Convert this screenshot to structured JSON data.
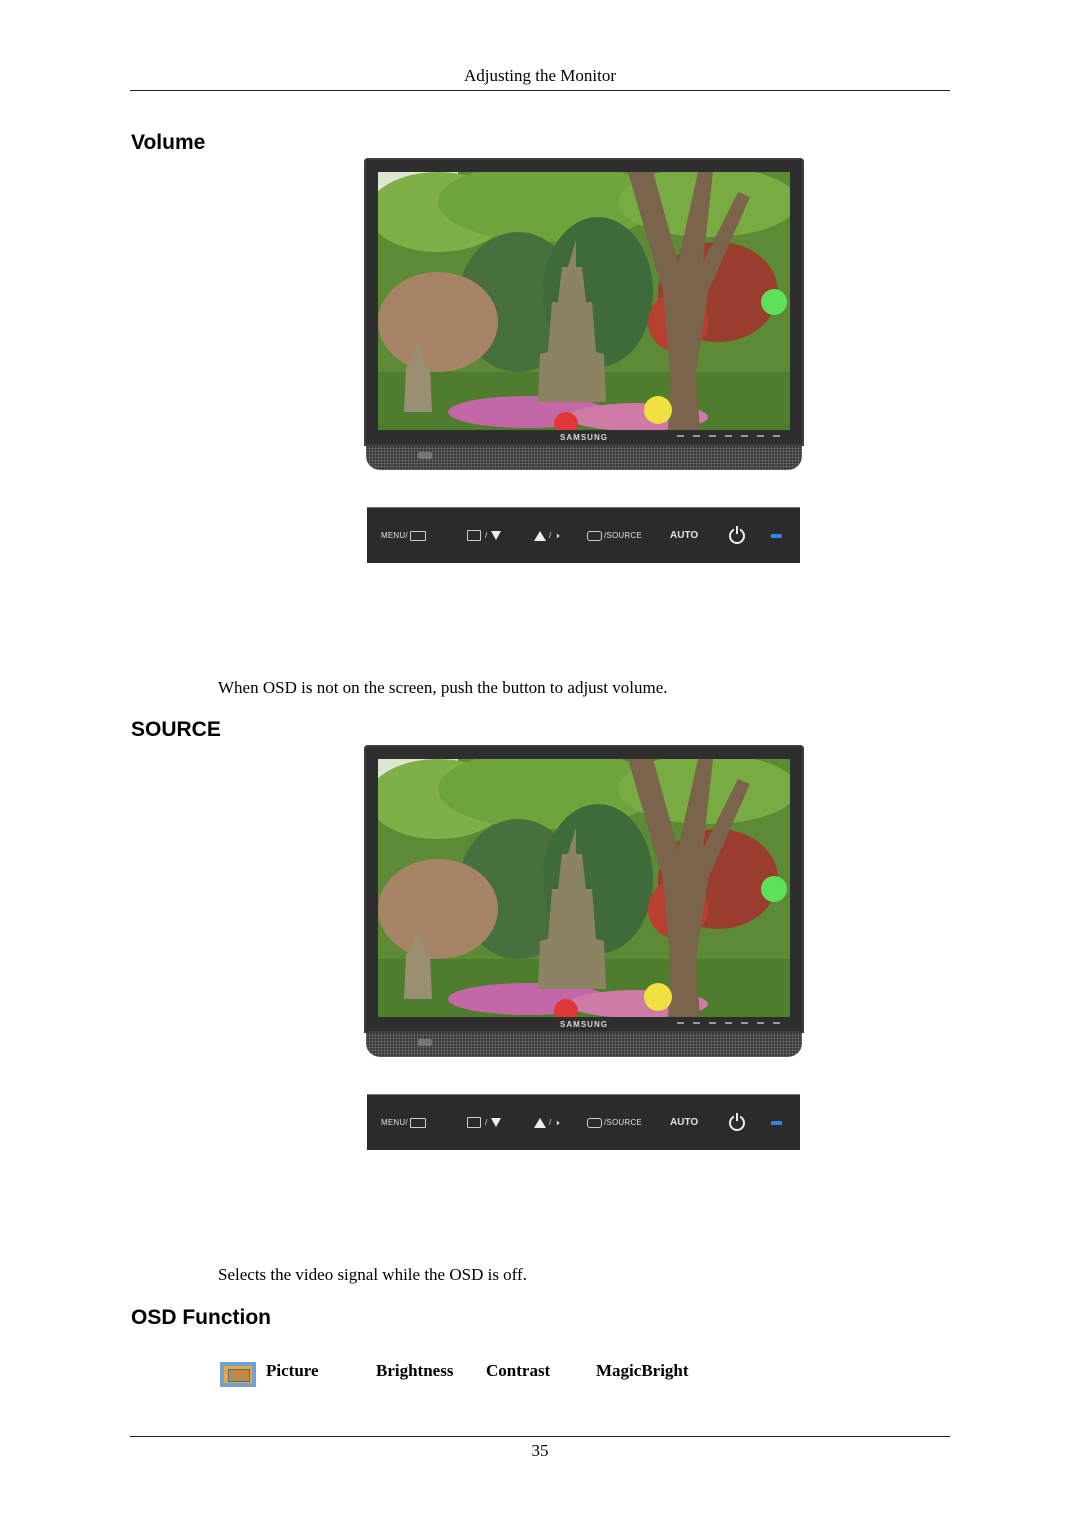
{
  "header": {
    "title": "Adjusting the Monitor"
  },
  "sections": [
    {
      "title": "Volume",
      "monitor": {
        "brand": "SAMSUNG"
      },
      "button_bar": {
        "menu": "MENU/",
        "source": "/SOURCE",
        "auto": "AUTO"
      },
      "description": "When OSD is not on the screen, push the button to adjust volume."
    },
    {
      "title": "SOURCE",
      "monitor": {
        "brand": "SAMSUNG"
      },
      "button_bar": {
        "menu": "MENU/",
        "source": "/SOURCE",
        "auto": "AUTO"
      },
      "description": "Selects the video signal while the OSD is off."
    },
    {
      "title": "OSD Function",
      "osd_items": [
        "Picture",
        "Brightness",
        "Contrast",
        "MagicBright"
      ]
    }
  ],
  "footer": {
    "page_number": "35"
  },
  "colors": {
    "led_blue": "#2f86e6",
    "bezel": "#2e2e2e",
    "osd_icon_frame": "#6fa0cf",
    "osd_icon_fill": "#f0a33c"
  }
}
